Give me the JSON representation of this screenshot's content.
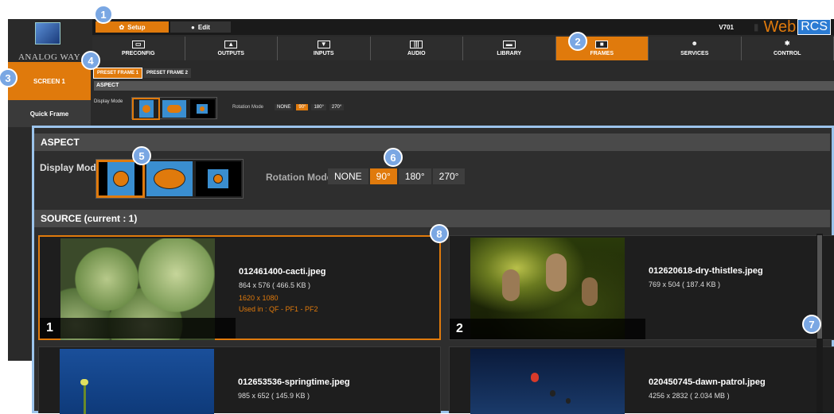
{
  "topbar": {
    "setup_label": "Setup",
    "edit_label": "Edit",
    "version": "V701",
    "web": "Web",
    "rcs": "RCS"
  },
  "brand": "ANALOG WAY",
  "nav": [
    {
      "label": "PRECONFIG",
      "icon": "preconfig-icon",
      "active": false
    },
    {
      "label": "OUTPUTS",
      "icon": "outputs-icon",
      "active": false
    },
    {
      "label": "INPUTS",
      "icon": "inputs-icon",
      "active": false
    },
    {
      "label": "AUDIO",
      "icon": "audio-icon",
      "active": false
    },
    {
      "label": "LIBRARY",
      "icon": "library-icon",
      "active": false
    },
    {
      "label": "FRAMES",
      "icon": "frames-icon",
      "active": true
    },
    {
      "label": "SERVICES",
      "icon": "services-icon",
      "active": false
    },
    {
      "label": "CONTROL",
      "icon": "control-icon",
      "active": false
    }
  ],
  "sidebar": {
    "screen": "SCREEN 1",
    "quick": "Quick Frame"
  },
  "subtabs": {
    "pf1": "PRESET FRAME 1",
    "pf2": "PRESET FRAME 2"
  },
  "aspect": {
    "title": "ASPECT",
    "display_mode": "Display Mode",
    "rotation_mode": "Rotation Mode"
  },
  "rotation": [
    "NONE",
    "90°",
    "180°",
    "270°"
  ],
  "source": {
    "title": "SOURCE (current : 1)"
  },
  "cards": [
    {
      "num": "1",
      "name": "012461400-cacti.jpeg",
      "size": "864 x 576 ( 466.5 KB )",
      "res": "1620 x 1080",
      "used": "Used in : QF - PF1 - PF2"
    },
    {
      "num": "2",
      "name": "012620618-dry-thistles.jpeg",
      "size": "769 x 504 ( 187.4 KB )"
    },
    {
      "name": "012653536-springtime.jpeg",
      "size": "985 x 652 ( 145.9 KB )"
    },
    {
      "name": "020450745-dawn-patrol.jpeg",
      "size": "4256 x 2832 ( 2.034 MB )"
    }
  ],
  "callouts": [
    "1",
    "2",
    "3",
    "4",
    "5",
    "6",
    "7",
    "8"
  ],
  "colors": {
    "accent": "#e07a0c",
    "callout": "#7aa7e3",
    "highlight": "#9cc4ec"
  }
}
